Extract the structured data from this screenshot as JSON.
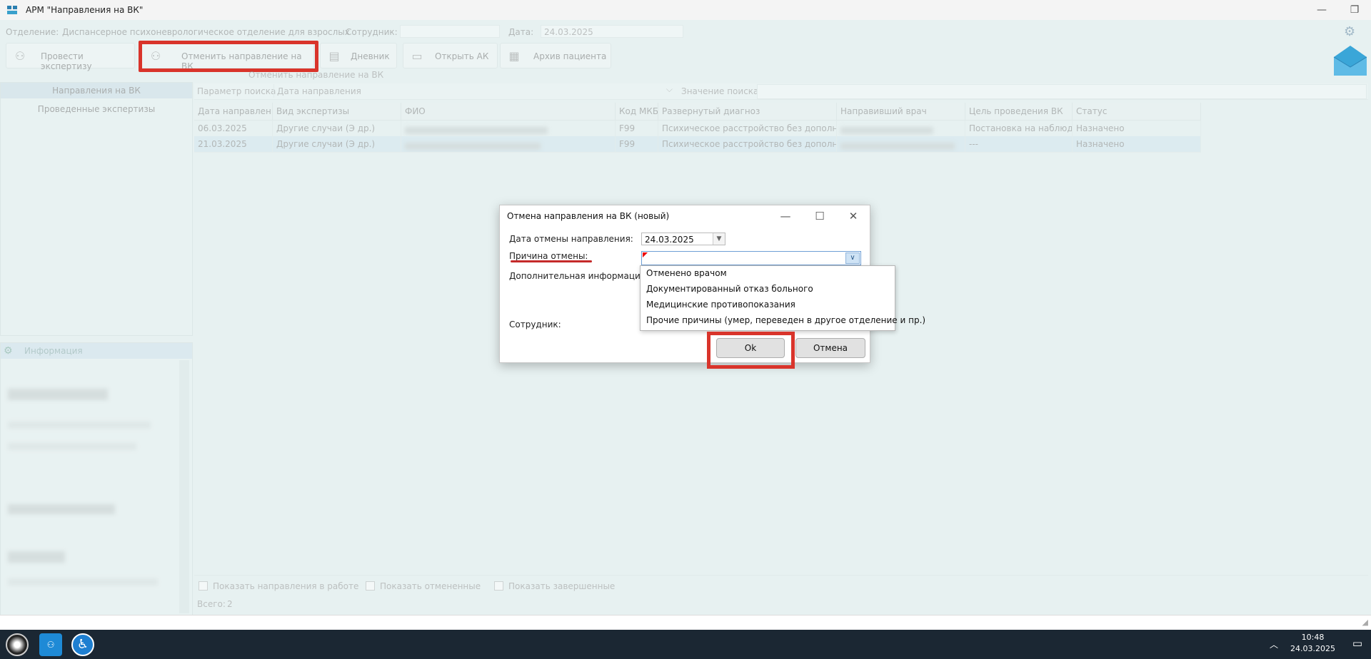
{
  "window": {
    "title": "АРМ \"Направления на ВК\""
  },
  "header": {
    "department_label": "Отделение:",
    "department_value": "Диспансерное психоневрологическое отделение для взрослых",
    "employee_label": "Сотрудник:",
    "date_label": "Дата:",
    "date_value": "24.03.2025"
  },
  "toolbar": {
    "buttons": [
      {
        "label": "Провести экспертизу",
        "icon": "people-search-icon"
      },
      {
        "label": "Отменить направление на ВК",
        "icon": "people-cancel-icon"
      },
      {
        "label": "Дневник",
        "icon": "book-icon"
      },
      {
        "label": "Открыть АК",
        "icon": "archive-box-icon"
      },
      {
        "label": "Архив пациента",
        "icon": "patient-archive-icon"
      }
    ],
    "tooltip": "Отменить направление на ВК"
  },
  "left_panel": {
    "items": [
      "Направления на ВК",
      "Проведенные экспертизы"
    ],
    "info_title": "Информация"
  },
  "search": {
    "param_label": "Параметр поиска",
    "param_value": "Дата направления",
    "value_label": "Значение поиска"
  },
  "table": {
    "columns": [
      "Дата направления",
      "Вид экспертизы",
      "ФИО",
      "Код МКБ",
      "Развернутый диагноз",
      "Направивший врач",
      "Цель проведения ВК",
      "Статус"
    ],
    "rows": [
      [
        "06.03.2025",
        "Другие случаи (Э др.)",
        "",
        "F99",
        "Психическое расстройство без дополните...",
        "",
        "Постановка на наблюде...",
        "Назначено"
      ],
      [
        "21.03.2025",
        "Другие случаи (Э др.)",
        "",
        "F99",
        "Психическое расстройство без дополните...",
        "",
        "---",
        "Назначено"
      ]
    ]
  },
  "footer": {
    "checkboxes": [
      "Показать направления в работе",
      "Показать отмененные",
      "Показать завершенные"
    ],
    "total_label": "Всего:",
    "total_value": "2"
  },
  "dialog": {
    "title": "Отмена направления на ВК (новый)",
    "cancel_date_label": "Дата отмены направления:",
    "cancel_date_value": "24.03.2025",
    "reason_label": "Причина отмены:",
    "extra_info_label": "Дополнительная информация:",
    "employee_label": "Сотрудник:",
    "ok_label": "Ok",
    "cancel_label": "Отмена",
    "reason_options": [
      "Отменено врачом",
      "Документированный отказ больного",
      "Медицинские противопоказания",
      "Прочие причины (умер, переведен в другое отделение и пр.)"
    ]
  },
  "taskbar": {
    "time": "10:48",
    "date": "24.03.2025"
  },
  "colors": {
    "highlight": "#d9342b",
    "taskbar": "#1b2733"
  }
}
